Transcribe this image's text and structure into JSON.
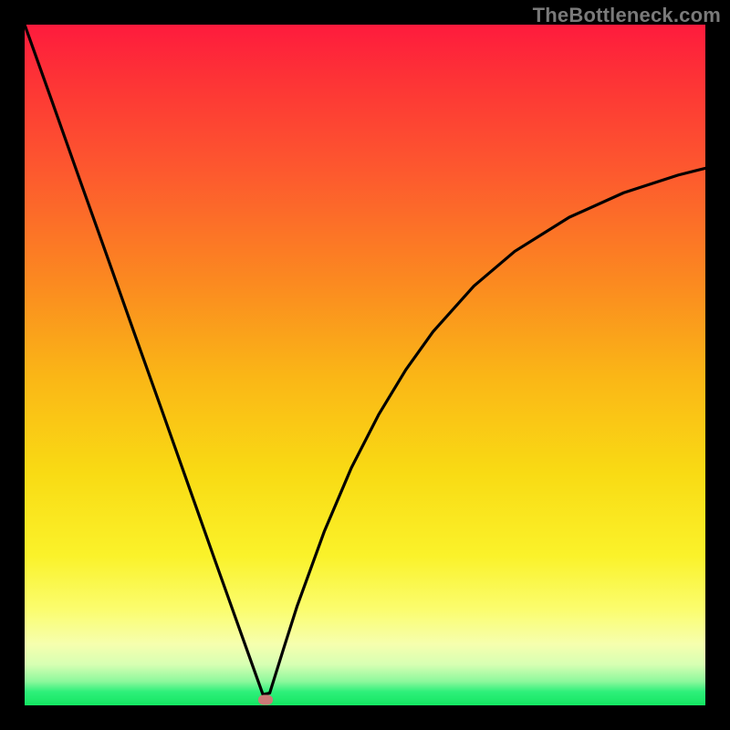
{
  "watermark": "TheBottleneck.com",
  "chart_data": {
    "type": "line",
    "title": "",
    "xlabel": "",
    "ylabel": "",
    "xlim": [
      0,
      100
    ],
    "ylim": [
      0,
      100
    ],
    "x": [
      0,
      4,
      8,
      12,
      16,
      20,
      24,
      28,
      30,
      32,
      33,
      34,
      35,
      36,
      38,
      40,
      44,
      48,
      52,
      56,
      60,
      66,
      72,
      80,
      88,
      96,
      100
    ],
    "y": [
      100,
      88.8,
      77.5,
      66.3,
      55.0,
      43.8,
      32.5,
      21.2,
      15.6,
      10.0,
      7.2,
      4.4,
      1.6,
      1.8,
      8.2,
      14.5,
      25.5,
      34.9,
      42.7,
      49.3,
      54.9,
      61.6,
      66.7,
      71.7,
      75.3,
      77.9,
      78.9
    ],
    "marker": {
      "x": 35.4,
      "y": 0.8
    },
    "colors": {
      "curve": "#000000",
      "gradient_top": "#fe1b3d",
      "gradient_mid": "#f9db14",
      "gradient_bottom": "#14e662",
      "marker": "#cb7a77"
    }
  }
}
